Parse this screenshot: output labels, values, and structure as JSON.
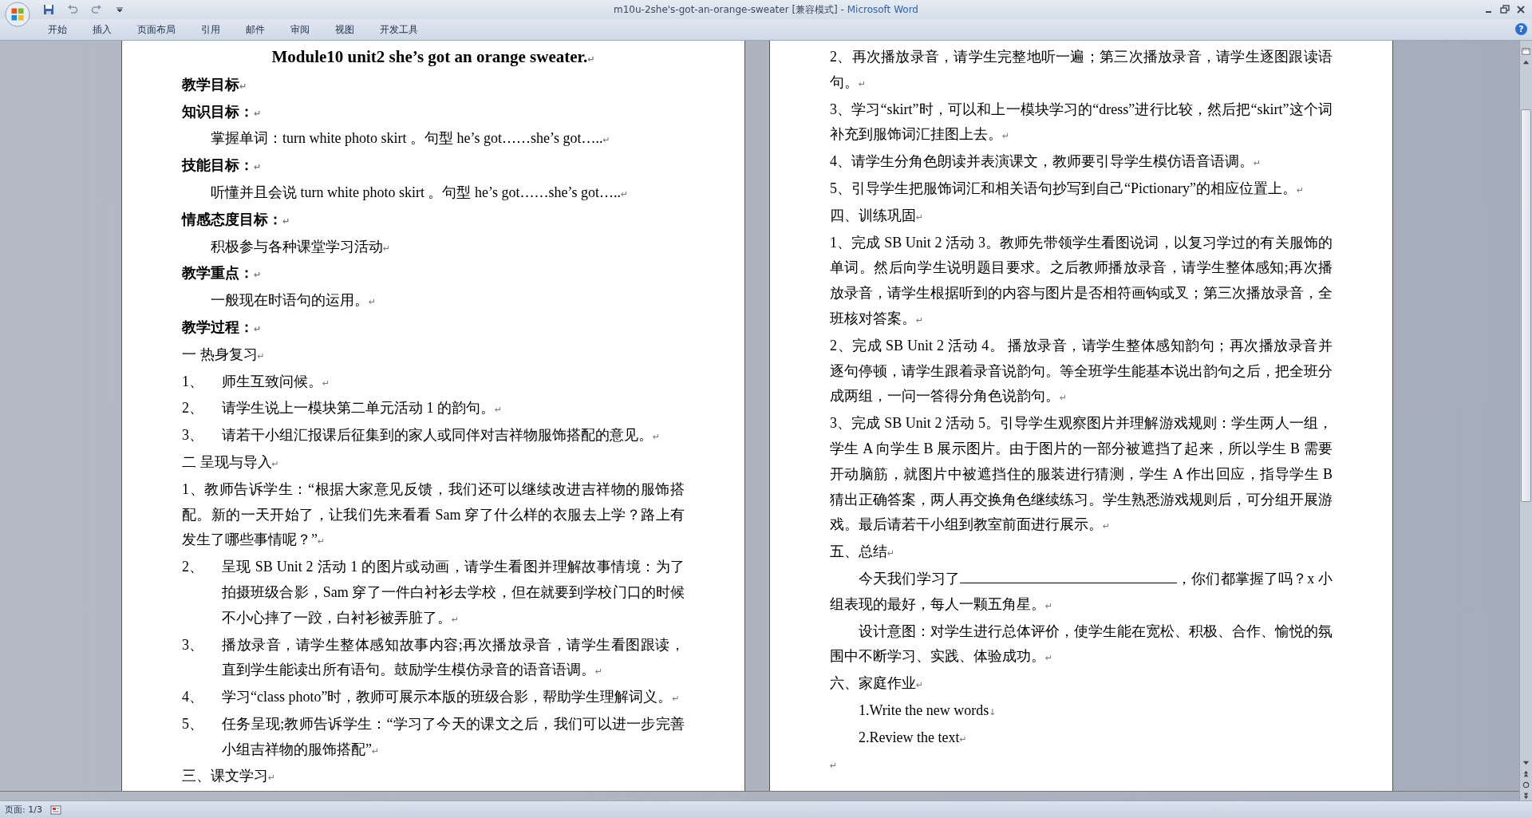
{
  "window": {
    "title": "m10u-2she's-got-an-orange-sweater [兼容模式]",
    "separator": " - ",
    "app_name": "Microsoft Word"
  },
  "ribbon": {
    "tabs": [
      {
        "label": "开始",
        "selected": false
      },
      {
        "label": "插入",
        "selected": false
      },
      {
        "label": "页面布局",
        "selected": false
      },
      {
        "label": "引用",
        "selected": false
      },
      {
        "label": "邮件",
        "selected": false
      },
      {
        "label": "审阅",
        "selected": false
      },
      {
        "label": "视图",
        "selected": false
      },
      {
        "label": "开发工具",
        "selected": false
      }
    ],
    "help": "?"
  },
  "pages": [
    {
      "paragraphs": [
        {
          "kind": "title",
          "text": "Module10 unit2 she’s got an orange sweater.",
          "mark": "↵"
        },
        {
          "kind": "heading",
          "text": "教学目标",
          "mark": "↵"
        },
        {
          "kind": "heading",
          "text": "知识目标：",
          "mark": "↵"
        },
        {
          "kind": "indent",
          "text": "掌握单词：turn white photo skirt 。句型 he’s got……she’s got…..",
          "mark": "↵"
        },
        {
          "kind": "heading",
          "text": "技能目标：",
          "mark": "↵"
        },
        {
          "kind": "indent",
          "text": "听懂并且会说 turn white photo skirt 。句型 he’s got……she’s got…..",
          "mark": "↵"
        },
        {
          "kind": "heading",
          "text": "情感态度目标：",
          "mark": "↵"
        },
        {
          "kind": "indent",
          "text": "积极参与各种课堂学习活动",
          "mark": "↵"
        },
        {
          "kind": "heading",
          "text": "教学重点：",
          "mark": "↵"
        },
        {
          "kind": "indent",
          "text": "一般现在时语句的运用。",
          "mark": "↵"
        },
        {
          "kind": "heading",
          "text": "教学过程：",
          "mark": "↵"
        },
        {
          "kind": "plain",
          "text": "一  热身复习",
          "mark": "↵"
        },
        {
          "kind": "numbered",
          "number": "1、",
          "text": "师生互致问候。",
          "mark": "↵"
        },
        {
          "kind": "numbered",
          "number": "2、",
          "text": "请学生说上一模块第二单元活动 1 的韵句。",
          "mark": "↵"
        },
        {
          "kind": "numbered",
          "number": "3、",
          "text": "请若干小组汇报课后征集到的家人或同伴对吉祥物服饰搭配的意见。",
          "mark": "↵"
        },
        {
          "kind": "plain",
          "text": "二    呈现与导入",
          "mark": "↵"
        },
        {
          "kind": "plain",
          "text": "1、教师告诉学生：“根据大家意见反馈，我们还可以继续改进吉祥物的服饰搭配。新的一天开始了，让我们先来看看 Sam 穿了什么样的衣服去上学？路上有发生了哪些事情呢？”",
          "mark": "↵"
        },
        {
          "kind": "numbered",
          "number": "2、",
          "text": "呈现 SB Unit 2 活动 1 的图片或动画，请学生看图并理解故事情境：为了拍摄班级合影，Sam 穿了一件白衬衫去学校，但在就要到学校门口的时候不小心摔了一跤，白衬衫被弄脏了。",
          "mark": "↵"
        },
        {
          "kind": "numbered",
          "number": "3、",
          "text": "播放录音，请学生整体感知故事内容;再次播放录音，请学生看图跟读，直到学生能读出所有语句。鼓励学生模仿录音的语音语调。",
          "mark": "↵"
        },
        {
          "kind": "numbered",
          "number": "4、",
          "text": "学习“class photo”时，教师可展示本版的班级合影，帮助学生理解词义。",
          "mark": "↵"
        },
        {
          "kind": "numbered",
          "number": "5、",
          "text": "任务呈现;教师告诉学生：“学习了今天的课文之后，我们可以进一步完善小组吉祥物的服饰搭配”",
          "mark": "↵"
        },
        {
          "kind": "plain",
          "text": "三、课文学习",
          "mark": "↵"
        }
      ]
    },
    {
      "paragraphs": [
        {
          "kind": "plain",
          "text": "2、再次播放录音，请学生完整地听一遍；第三次播放录音，请学生逐图跟读语句。",
          "mark": "↵"
        },
        {
          "kind": "plain",
          "text": "3、学习“skirt”时，可以和上一模块学习的“dress”进行比较，然后把“skirt”这个词补充到服饰词汇挂图上去。",
          "mark": "↵"
        },
        {
          "kind": "plain",
          "text": "4、请学生分角色朗读并表演课文，教师要引导学生模仿语音语调。",
          "mark": "↵"
        },
        {
          "kind": "plain",
          "text": "5、引导学生把服饰词汇和相关语句抄写到自己“Pictionary”的相应位置上。",
          "mark": "↵"
        },
        {
          "kind": "plain",
          "text": "四、训练巩固",
          "mark": "↵"
        },
        {
          "kind": "plain",
          "text": "1、完成 SB Unit 2 活动 3。教师先带领学生看图说词，以复习学过的有关服饰的单词。然后向学生说明题目要求。之后教师播放录音，请学生整体感知;再次播放录音，请学生根据听到的内容与图片是否相符画钩或叉；第三次播放录音，全班核对答案。",
          "mark": "↵"
        },
        {
          "kind": "plain",
          "text": "2、完成 SB Unit 2 活动 4。 播放录音，请学生整体感知韵句；再次播放录音并逐句停顿，请学生跟着录音说韵句。等全班学生能基本说出韵句之后，把全班分成两组，一问一答得分角色说韵句。",
          "mark": "↵"
        },
        {
          "kind": "plain",
          "text": "3、完成 SB Unit 2 活动 5。引导学生观察图片并理解游戏规则：学生两人一组，学生 A 向学生 B 展示图片。由于图片的一部分被遮挡了起来，所以学生 B 需要开动脑筋，就图片中被遮挡住的服装进行猜测，学生 A 作出回应，指导学生 B 猜出正确答案，两人再交换角色继续练习。学生熟悉游戏规则后，可分组开展游戏。最后请若干小组到教室前面进行展示。",
          "mark": "↵"
        },
        {
          "kind": "plain",
          "text": "五、总结",
          "mark": "↵"
        },
        {
          "kind": "fill_in",
          "before": "今天我们学习了",
          "after": "，你们都掌握了吗？x 小组表现的最好，每人一颗五角星。",
          "mark": "↵"
        },
        {
          "kind": "indent",
          "text": "设计意图：对学生进行总体评价，使学生能在宽松、积极、合作、愉悦的氛围中不断学习、实践、体验成功。",
          "mark": "↵"
        },
        {
          "kind": "plain",
          "text": "六、家庭作业",
          "mark": "↵"
        },
        {
          "kind": "indent",
          "text": "1.Write the new words",
          "mark": "↓"
        },
        {
          "kind": "indent",
          "text": "2.Review the text",
          "mark": "↵"
        },
        {
          "kind": "empty",
          "mark": "↵"
        }
      ]
    }
  ],
  "status_bar": {
    "page_indicator": "页面: 1/3"
  }
}
